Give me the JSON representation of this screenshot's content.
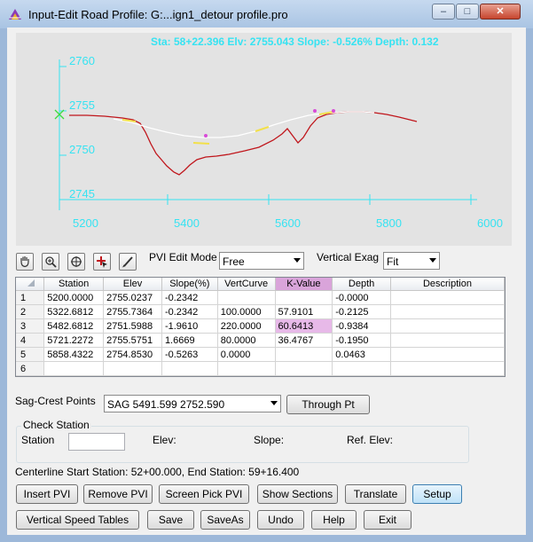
{
  "window": {
    "title": "Input-Edit Road Profile: G:...ign1_detour profile.pro",
    "minimize": "–",
    "maximize": "□",
    "close": "✕"
  },
  "plot": {
    "readout": "Sta: 58+22.396 Elv: 2755.043 Slope: -0.526% Depth: 0.132",
    "y_ticks": [
      "2760",
      "2755",
      "2750",
      "2745"
    ],
    "x_ticks": [
      "5200",
      "5400",
      "5600",
      "5800",
      "6000"
    ],
    "colors": {
      "background": "#e3e3e3",
      "axis": "#36e3f2",
      "ground": "#c0161c",
      "design": "#ffffff",
      "tangent": "#f2e04a",
      "pvi": "#d84bd8",
      "marker": "#3ddc3d"
    }
  },
  "toolbar": {
    "icons": [
      "pan-hand-icon",
      "zoom-icon",
      "zoom-extents-icon",
      "pick-point-icon",
      "edit-pencil-icon"
    ],
    "pvi_edit_mode_label": "PVI Edit Mode",
    "pvi_edit_mode_value": "Free",
    "vertical_exag_label": "Vertical Exag",
    "vertical_exag_value": "Fit"
  },
  "grid": {
    "columns": [
      "Station",
      "Elev",
      "Slope(%)",
      "VertCurve",
      "K-Value",
      "Depth",
      "Description"
    ],
    "rows": [
      {
        "num": "1",
        "station": "5200.0000",
        "elev": "2755.0237",
        "slope": "-0.2342",
        "vertcurve": "",
        "kvalue": "",
        "depth": "-0.0000",
        "description": ""
      },
      {
        "num": "2",
        "station": "5322.6812",
        "elev": "2755.7364",
        "slope": "-0.2342",
        "vertcurve": "100.0000",
        "kvalue": "57.9101",
        "depth": "-0.2125",
        "description": ""
      },
      {
        "num": "3",
        "station": "5482.6812",
        "elev": "2751.5988",
        "slope": "-1.9610",
        "vertcurve": "220.0000",
        "kvalue": "60.6413",
        "depth": "-0.9384",
        "description": ""
      },
      {
        "num": "4",
        "station": "5721.2272",
        "elev": "2755.5751",
        "slope": "1.6669",
        "vertcurve": "80.0000",
        "kvalue": "36.4767",
        "depth": "-0.1950",
        "description": ""
      },
      {
        "num": "5",
        "station": "5858.4322",
        "elev": "2754.8530",
        "slope": "-0.5263",
        "vertcurve": "0.0000",
        "kvalue": "",
        "depth": "0.0463",
        "description": ""
      },
      {
        "num": "6",
        "station": "",
        "elev": "",
        "slope": "",
        "vertcurve": "",
        "kvalue": "",
        "depth": "",
        "description": ""
      }
    ]
  },
  "sag_crest": {
    "label": "Sag-Crest Points",
    "value": "SAG 5491.599 2752.590",
    "through_pt": "Through Pt"
  },
  "check_station": {
    "title": "Check Station",
    "station_label": "Station",
    "station_value": "",
    "elev_label": "Elev:",
    "slope_label": "Slope:",
    "ref_elev_label": "Ref. Elev:"
  },
  "status": "Centerline Start Station: 52+00.000, End Station: 59+16.400",
  "buttons_row1": [
    "Insert PVI",
    "Remove PVI",
    "Screen Pick PVI",
    "Show Sections",
    "Translate",
    "Setup"
  ],
  "buttons_row2": [
    "Vertical Speed Tables",
    "Save",
    "SaveAs",
    "Undo",
    "Help",
    "Exit"
  ]
}
